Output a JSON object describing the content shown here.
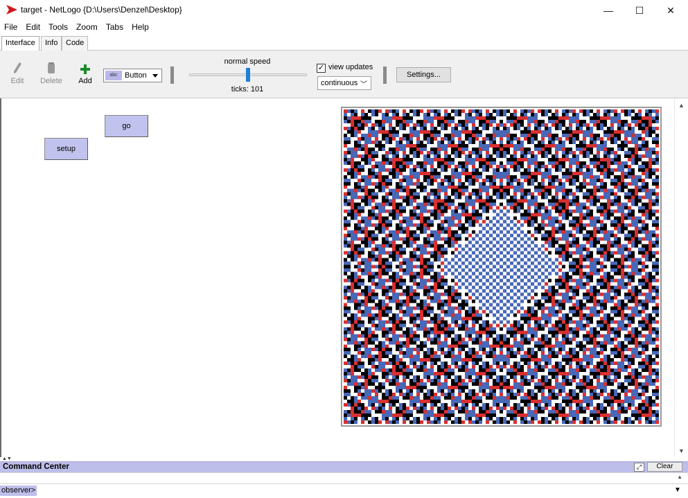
{
  "window": {
    "title": "target - NetLogo {D:\\Users\\Denzel\\Desktop}",
    "minimize_glyph": "—",
    "maximize_glyph": "☐",
    "close_glyph": "✕"
  },
  "menu": [
    "File",
    "Edit",
    "Tools",
    "Zoom",
    "Tabs",
    "Help"
  ],
  "tabs": [
    {
      "label": "Interface",
      "active": true
    },
    {
      "label": "Info",
      "active": false
    },
    {
      "label": "Code",
      "active": false
    }
  ],
  "toolbar": {
    "edit_label": "Edit",
    "delete_label": "Delete",
    "add_label": "Add",
    "widget_chip": "abc",
    "widget_type": "Button",
    "speed_label": "normal speed",
    "speed_fraction": 0.5,
    "ticks_label": "ticks: 101",
    "view_updates_checked": true,
    "view_updates_check_glyph": "✓",
    "view_updates_label": "view updates",
    "update_mode": "continuous",
    "settings_label": "Settings..."
  },
  "interface": {
    "buttons": [
      {
        "label": "go"
      },
      {
        "label": "setup"
      }
    ],
    "world_palette": [
      "#ffffff",
      "#000000",
      "#d93030",
      "#4868b8"
    ]
  },
  "command_center": {
    "title": "Command Center",
    "clear_label": "Clear",
    "prompt": "observer>",
    "input_value": ""
  },
  "colors": {
    "accent": "#1e7fd6",
    "button_fill": "#c2c2ee",
    "header_fill": "#bebeea",
    "add_icon": "#1a8a2a",
    "app_icon": "#d01818"
  },
  "icons": {
    "app": "netlogo-arrow-icon",
    "edit": "pencil-icon",
    "delete": "trash-icon",
    "add": "plus-icon"
  }
}
